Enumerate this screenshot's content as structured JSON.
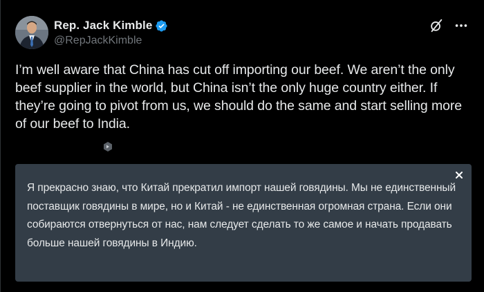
{
  "author": {
    "display_name": "Rep. Jack Kimble",
    "handle": "@RepJackKimble",
    "verified": true
  },
  "tweet": {
    "text": "I’m well aware that China has cut off importing our beef. We aren’t the only beef supplier in the world, but China isn’t the only huge country either. If they’re going to pivot from us, we should do the same and start selling more of our beef to India."
  },
  "translation": {
    "text": "Я прекрасно знаю, что Китай прекратил импорт нашей говядины. Мы не единственный поставщик говядины в мире, но и Китай - не единственная огромная страна. Если они собираются отвернуться от нас, нам следует сделать то же самое и начать продавать больше нашей говядины в Индию."
  },
  "icons": {
    "verified": "verified-badge-icon",
    "grok": "grok-icon",
    "more": "more-options-icon",
    "translate": "translate-icon",
    "close": "close-icon"
  },
  "colors": {
    "background": "#000000",
    "text_primary": "#e7e9ea",
    "text_secondary": "#71767b",
    "verified_blue": "#1d9bf0",
    "translation_card": "#333d47"
  }
}
